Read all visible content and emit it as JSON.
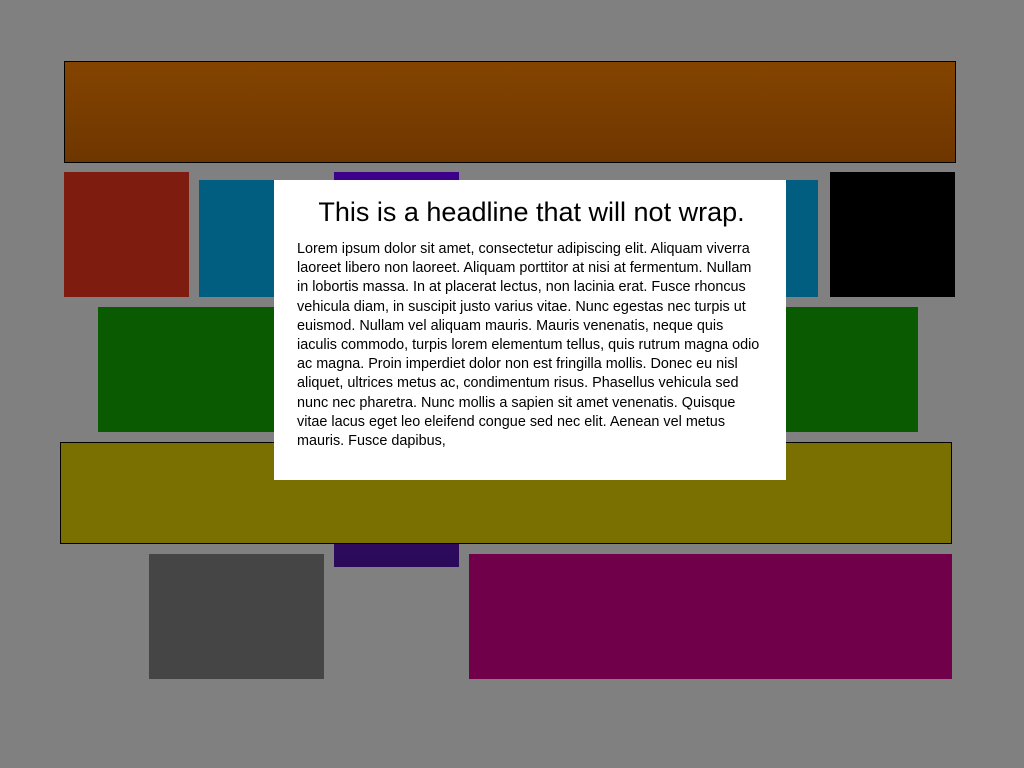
{
  "background_color": "#808080",
  "tiles": [
    {
      "name": "tile-brown",
      "color": "#844400"
    },
    {
      "name": "tile-red",
      "color": "#7e1c10"
    },
    {
      "name": "tile-blue-left",
      "color": "#015e80"
    },
    {
      "name": "tile-purple",
      "color": "#3c008a"
    },
    {
      "name": "tile-blue-right",
      "color": "#015e80"
    },
    {
      "name": "tile-black",
      "color": "#000000"
    },
    {
      "name": "tile-green",
      "color": "#0a5a02"
    },
    {
      "name": "tile-olive",
      "color": "#7a7002"
    },
    {
      "name": "tile-dark-grey",
      "color": "#454545"
    },
    {
      "name": "tile-magenta",
      "color": "#71004b"
    }
  ],
  "dialog": {
    "headline": "This is a headline that will not wrap.",
    "body": "Lorem ipsum dolor sit amet, consectetur adipiscing elit. Aliquam viverra laoreet libero non laoreet. Aliquam porttitor at nisi at fermentum. Nullam in lobortis massa. In at placerat lectus, non lacinia erat. Fusce rhoncus vehicula diam, in suscipit justo varius vitae. Nunc egestas nec turpis ut euismod. Nullam vel aliquam mauris. Mauris venenatis, neque quis iaculis commodo, turpis lorem elementum tellus, quis rutrum magna odio ac magna. Proin imperdiet dolor non est fringilla mollis. Donec eu nisl aliquet, ultrices metus ac, condimentum risus. Phasellus vehicula sed nunc nec pharetra. Nunc mollis a sapien sit amet venenatis. Quisque vitae lacus eget leo eleifend congue sed nec elit. Aenean vel metus mauris. Fusce dapibus,"
  }
}
